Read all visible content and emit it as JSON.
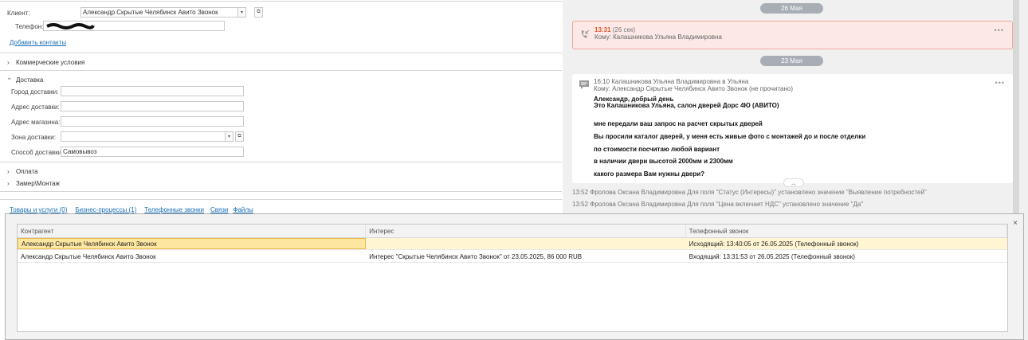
{
  "form": {
    "client_label": "Клиент:",
    "client_value": "Александр Скрытые Челябинск Авито Звонок",
    "phone_label": "Телефон:",
    "add_contacts": "Добавить контакты"
  },
  "sections": {
    "commercial": "Коммерческие условия",
    "delivery": "Доставка",
    "payment": "Оплата",
    "measure": "Замер\\Монтаж"
  },
  "delivery": {
    "city_label": "Город доставки:",
    "address_label": "Адрес доставки:",
    "store_label": "Адрес магазина:",
    "zone_label": "Зона доставки:",
    "method_label": "Способ доставки:",
    "method_value": "Самовывоз"
  },
  "bottom_tabs": [
    "Товары и услуги (0)",
    "Бизнес-процессы (1)",
    "Телефонные звонки",
    "Связи",
    "Файлы"
  ],
  "feed": {
    "date1": "26 Мая",
    "call": {
      "time": "13:31",
      "duration": "(26 сек)",
      "to": "Кому: Калашникова Ульяна Владимировна"
    },
    "date2": "23 Мая",
    "msg": {
      "header": "16:10 Калашникова Ульяна Владимировна в Ульяна",
      "to": "Кому: Александр Скрытые Челябинск Авито Звонок (не прочитано)",
      "lines": [
        "Александр, добрый день",
        "Это Калашникова Ульяна, салон дверей Дорс 4Ю (АВИТО)",
        "мне передали ваш запрос на расчет скрытых дверей",
        "Вы просили каталог дверей, у меня есть живые фото с монтажей до и после отделки",
        "по стоимости посчитаю любой вариант",
        "в наличии двери высотой 2000мм и 2300мм",
        "какого размера Вам нужны двери?"
      ]
    },
    "log": [
      "13:52 Фролова Оксана Владимировна Для поля \"Статус (Интересы)\" установлено значение \"Выявление потребностей\"",
      "13:52 Фролова Оксана Владимировна Для поля \"Цена включает НДС\" установлено значение \"Да\""
    ]
  },
  "modal": {
    "columns": [
      "Контрагент",
      "Интерес",
      "Телефонный звонок"
    ],
    "rows": [
      [
        "Александр Скрытые Челябинск Авито Звонок",
        "",
        "Исходящий: 13:40:05 от 26.05.2025 (Телефонный звонок)"
      ],
      [
        "Александр Скрытые Челябинск Авито Звонок",
        "Интерес \"Скрытые Челябинск Авито Звонок\" от 23.05.2025, 86 000 RUB",
        "Входящий: 13:31:53 от 26.05.2025 (Телефонный звонок)"
      ]
    ],
    "close": "×"
  }
}
